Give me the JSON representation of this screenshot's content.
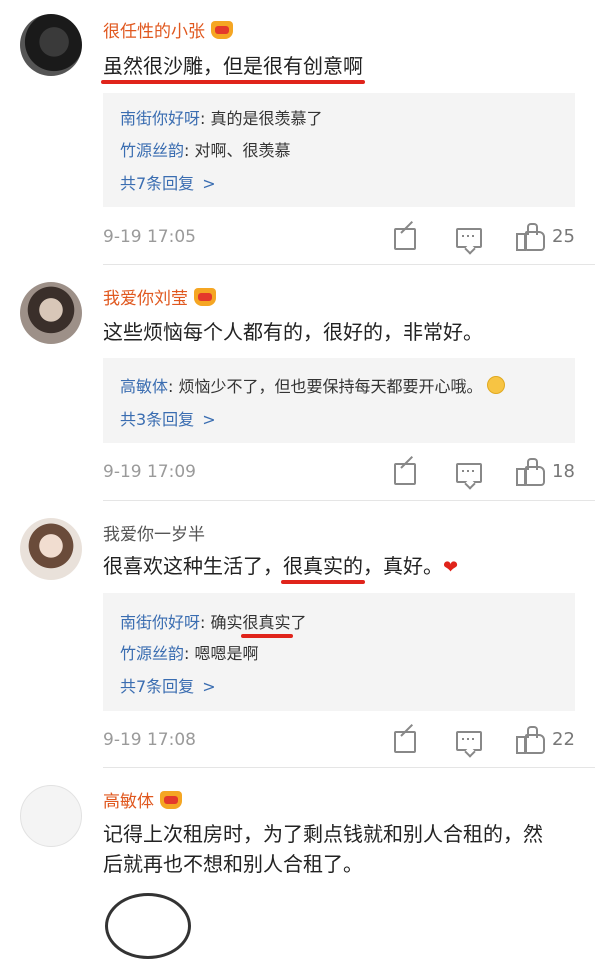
{
  "comments": [
    {
      "username": "很任性的小张",
      "has_badge": true,
      "text_before": "",
      "text_highlight": "虽然很沙雕，但是很有创意啊",
      "text_after": "",
      "replies": [
        {
          "user": "南街你好呀",
          "text_before": ": 真的是很羡慕了",
          "text_highlight": "",
          "text_after": ""
        },
        {
          "user": "竹源丝韵",
          "text_before": ": 对啊、很羡慕",
          "text_highlight": "",
          "text_after": ""
        }
      ],
      "more_replies": "共7条回复",
      "time": "9-19 17:05",
      "likes": "25"
    },
    {
      "username": "我爱你刘莹",
      "has_badge": true,
      "text_before": "这些烦恼每个人都有的，很好的，非常好。",
      "text_highlight": "",
      "text_after": "",
      "replies": [
        {
          "user": "高敏体",
          "text_before": ": 烦恼少不了，但也要保持每天都要开心哦。",
          "text_highlight": "",
          "text_after": ""
        }
      ],
      "more_replies": "共3条回复",
      "time": "9-19 17:09",
      "likes": "18"
    },
    {
      "username": "我爱你一岁半",
      "has_badge": false,
      "text_before": "很喜欢这种生活了，",
      "text_highlight": "很真实的",
      "text_after": "，真好。",
      "replies": [
        {
          "user": "南街你好呀",
          "text_before": ": 确实",
          "text_highlight": "很真实",
          "text_after": "了"
        },
        {
          "user": "竹源丝韵",
          "text_before": ": 嗯嗯是啊",
          "text_highlight": "",
          "text_after": ""
        }
      ],
      "more_replies": "共7条回复",
      "time": "9-19 17:08",
      "likes": "22"
    },
    {
      "username": "高敏体",
      "has_badge": true,
      "text_line1": "记得上次租房时，为了剩点钱就和别人合租的，然",
      "text_line2": "后就再也不想和别人合租了。"
    }
  ],
  "chevron": ">",
  "colors": {
    "username": "#e0581f",
    "link": "#3a6db1",
    "highlight_underline": "#e0241b"
  }
}
